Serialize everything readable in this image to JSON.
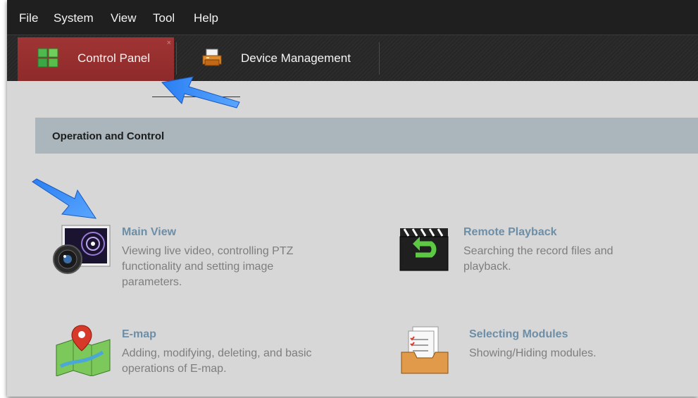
{
  "menu": {
    "items": [
      "File",
      "System",
      "View",
      "Tool",
      "Help"
    ]
  },
  "tabs": {
    "control_panel": {
      "label": "Control Panel",
      "close": "×"
    },
    "device_management": {
      "label": "Device Management"
    }
  },
  "section": {
    "title": "Operation and Control"
  },
  "features": {
    "main_view": {
      "title": "Main View",
      "desc": "Viewing live video, controlling PTZ functionality and setting image parameters."
    },
    "remote_playback": {
      "title": "Remote Playback",
      "desc": "Searching the record files and playback."
    },
    "emap": {
      "title": "E-map",
      "desc": "Adding, modifying, deleting, and basic operations of E-map."
    },
    "selecting_modules": {
      "title": "Selecting Modules",
      "desc": "Showing/Hiding modules."
    }
  },
  "colors": {
    "active_tab": "#9a3030",
    "feature_title": "#6c8ea6",
    "annotation_arrow": "#2e7cf0"
  }
}
